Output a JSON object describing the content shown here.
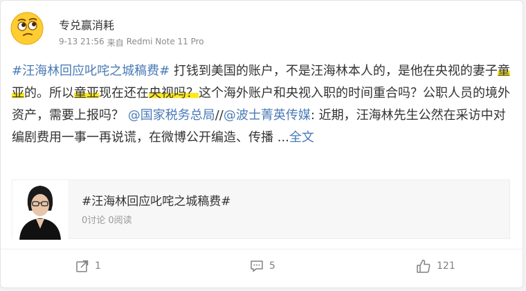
{
  "post": {
    "username": "专兑赢消耗",
    "time": "9-13 21:56",
    "source_prefix": "来自",
    "source": "Redmi Note 11 Pro",
    "text": {
      "hashtag": "#汪海林回应叱咤之城稿费#",
      "part1": "打钱到美国的账户，不是汪海林本人的，是他在央视的妻子",
      "name1": "童亚",
      "part2": "的。所以",
      "name2": "童亚",
      "part3": "现在还在",
      "cctv": "央视吗？",
      "part4": "这个海外账户和央视入职的时间重合吗？公职人员的境外资产，需要上报吗？",
      "mention1": "@国家税务总局",
      "sep": "//",
      "mention2": "@波士菁英传媒",
      "part5": ": 近期，汪海林先生公然在采访中对编剧费用一事一再说谎，在微博公开编造、传播 ...",
      "full_text_link": "全文"
    },
    "quote": {
      "title": "#汪海林回应叱咤之城稿费#",
      "meta": "0讨论 0阅读"
    },
    "actions": {
      "repost_count": "1",
      "comment_count": "5",
      "like_count": "121"
    }
  },
  "colors": {
    "link": "#4a7ab7",
    "highlight": "#ffe81a",
    "text": "#333333",
    "muted": "#8b8b8b"
  },
  "icons": {
    "avatar": "emoji-face-avatar",
    "repost": "repost-icon",
    "comment": "comment-icon",
    "like": "thumbs-up-icon"
  }
}
